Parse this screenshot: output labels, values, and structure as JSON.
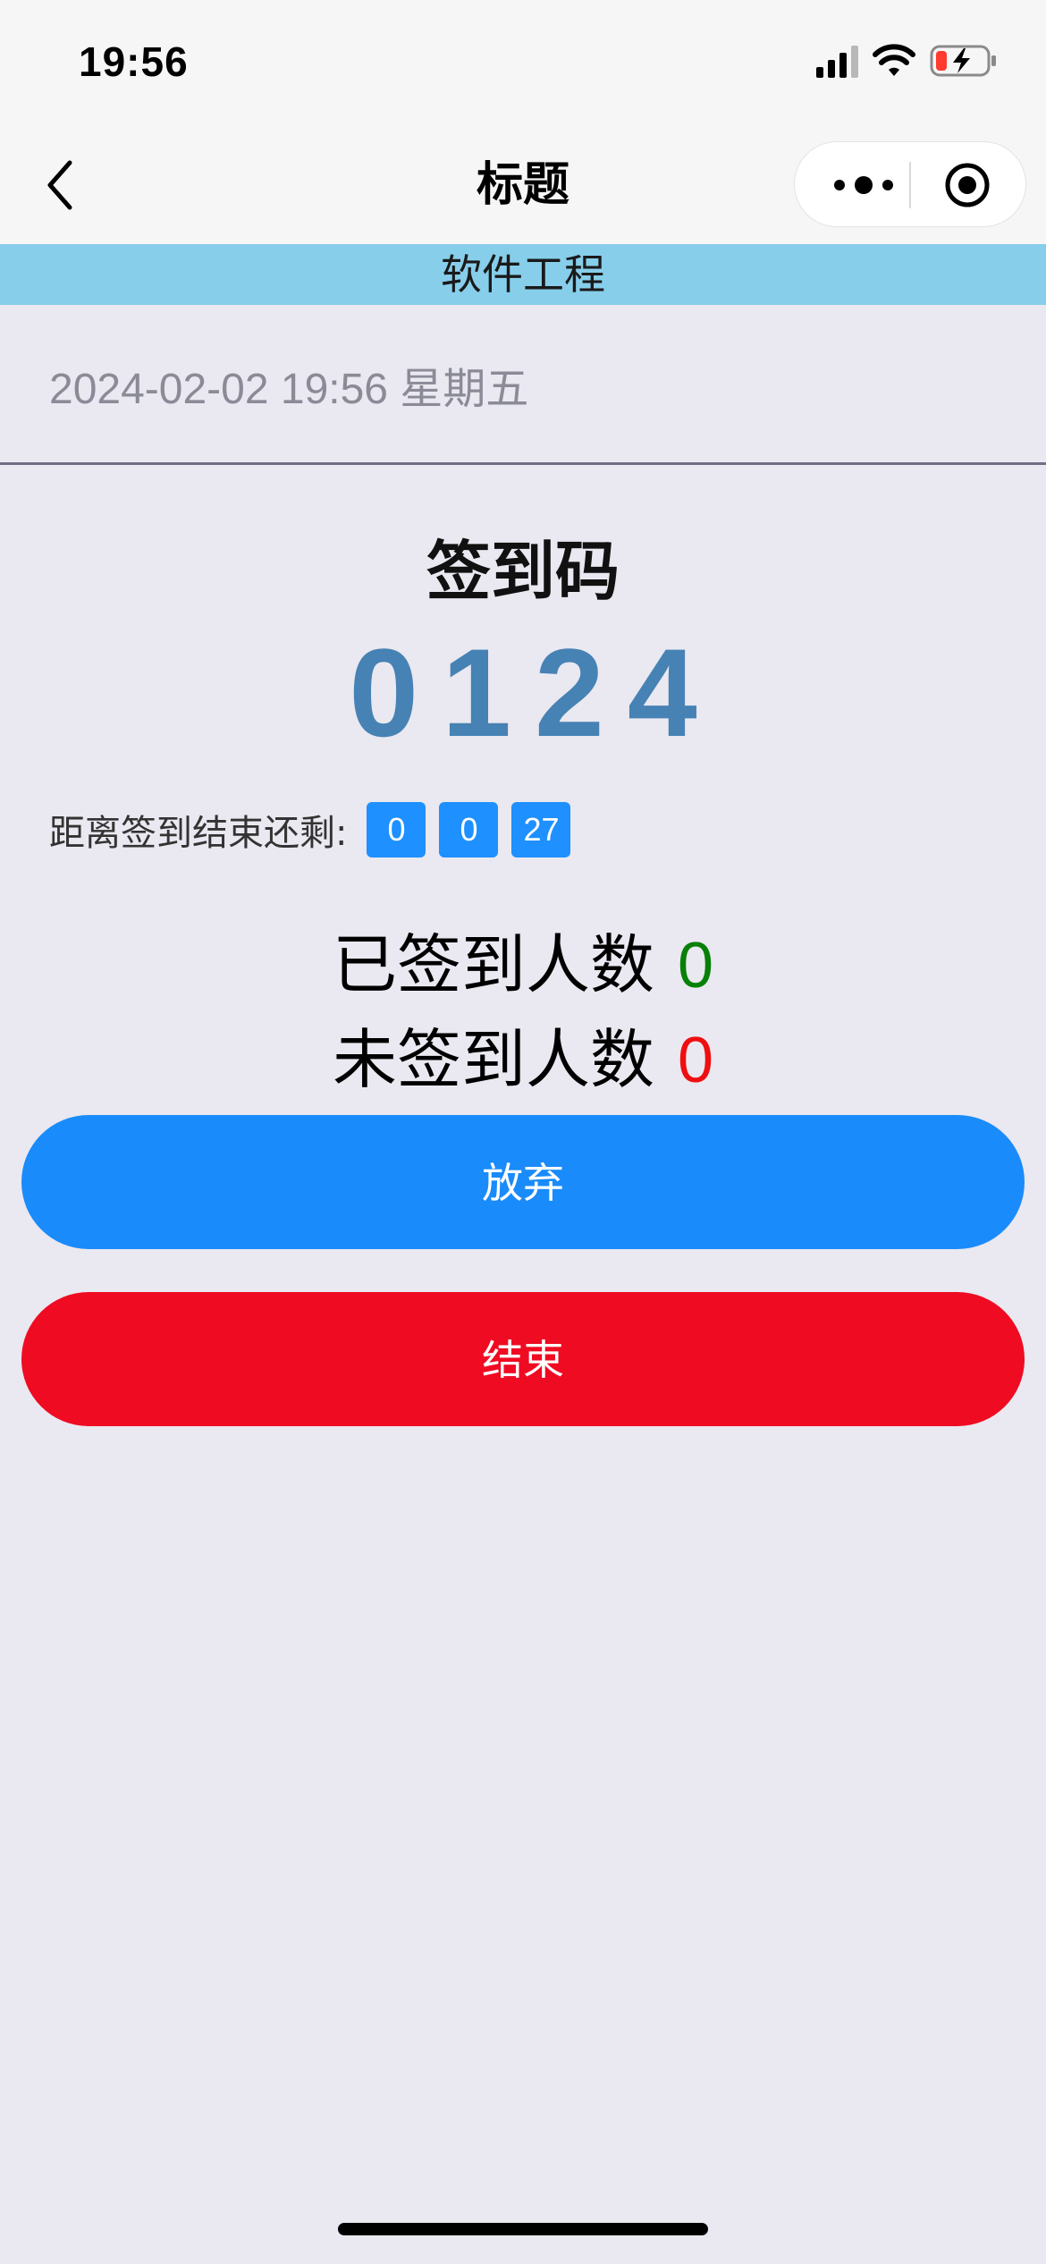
{
  "status_bar": {
    "time": "19:56",
    "icons": [
      "cellular-signal-icon",
      "wifi-icon",
      "battery-charging-icon"
    ]
  },
  "nav": {
    "title": "标题",
    "back_icon": "chevron-left-icon",
    "capsule_icons": [
      "more-dots-icon",
      "target-circle-icon"
    ]
  },
  "course": {
    "name": "软件工程",
    "banner_color": "#87ceeb"
  },
  "date_line": "2024-02-02 19:56 星期五",
  "sign_code": {
    "label": "签到码",
    "value": "0124",
    "color": "#4682b4"
  },
  "countdown": {
    "label": "距离签到结束还剩:",
    "boxes": [
      "0",
      "0",
      "27"
    ],
    "box_color": "#1e90ff"
  },
  "counts": {
    "signed_label": "已签到人数",
    "signed_value": "0",
    "signed_color": "#078007",
    "unsigned_label": "未签到人数",
    "unsigned_value": "0",
    "unsigned_color": "#ee0f11"
  },
  "buttons": {
    "abandon_label": "放弃",
    "abandon_color": "#1a8bfa",
    "end_label": "结束",
    "end_color": "#ef0b22"
  }
}
